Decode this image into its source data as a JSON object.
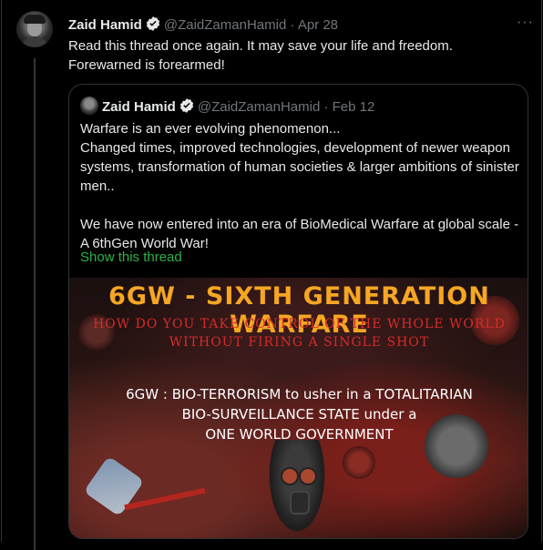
{
  "tweet": {
    "author_name": "Zaid Hamid",
    "handle": "@ZaidZamanHamid",
    "separator": "·",
    "date": "Apr 28",
    "text_line1": "Read this thread once again. It may save your life and freedom.",
    "text_line2": "Forewarned is forearmed!",
    "more_icon": "ellipsis-icon"
  },
  "quote": {
    "author_name": "Zaid Hamid",
    "handle": "@ZaidZamanHamid",
    "separator": "·",
    "date": "Feb 12",
    "lines": [
      "Warfare is an ever evolving phenomenon...",
      "Changed times, improved technologies, development of newer weapon systems, transformation of human societies & larger ambitions of sinister men.."
    ],
    "lines2": [
      "We have now entered into an era of BioMedical Warfare at global scale - A 6thGen World War!"
    ],
    "show_thread": "Show this thread"
  },
  "banner": {
    "title": "6GW - SIXTH GENERATION WARFARE",
    "subtitle_line1": "HOW DO YOU TAKE CONTROL OF THE WHOLE WORLD",
    "subtitle_line2": "WITHOUT FIRING A SINGLE SHOT",
    "body_line1": "6GW : BIO-TERRORISM to usher in a TOTALITARIAN",
    "body_line2": "BIO-SURVEILLANCE STATE under a",
    "body_line3": "ONE WORLD GOVERNMENT"
  },
  "colors": {
    "background": "#000000",
    "text": "#e7e9ea",
    "muted": "#71767b",
    "link": "#2cb24a",
    "banner_title": "#f5a623",
    "banner_subtitle": "#d42b2b"
  }
}
